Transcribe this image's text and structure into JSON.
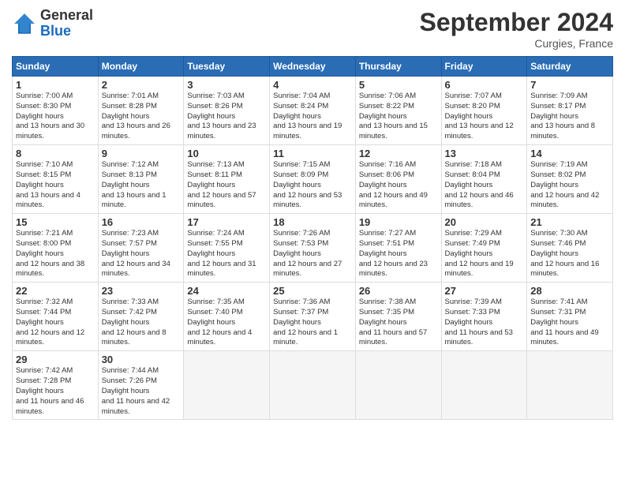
{
  "logo": {
    "general": "General",
    "blue": "Blue"
  },
  "title": "September 2024",
  "location": "Curgies, France",
  "headers": [
    "Sunday",
    "Monday",
    "Tuesday",
    "Wednesday",
    "Thursday",
    "Friday",
    "Saturday"
  ],
  "weeks": [
    [
      {
        "day": "1",
        "sunrise": "7:00 AM",
        "sunset": "8:30 PM",
        "daylight": "13 hours and 30 minutes."
      },
      {
        "day": "2",
        "sunrise": "7:01 AM",
        "sunset": "8:28 PM",
        "daylight": "13 hours and 26 minutes."
      },
      {
        "day": "3",
        "sunrise": "7:03 AM",
        "sunset": "8:26 PM",
        "daylight": "13 hours and 23 minutes."
      },
      {
        "day": "4",
        "sunrise": "7:04 AM",
        "sunset": "8:24 PM",
        "daylight": "13 hours and 19 minutes."
      },
      {
        "day": "5",
        "sunrise": "7:06 AM",
        "sunset": "8:22 PM",
        "daylight": "13 hours and 15 minutes."
      },
      {
        "day": "6",
        "sunrise": "7:07 AM",
        "sunset": "8:20 PM",
        "daylight": "13 hours and 12 minutes."
      },
      {
        "day": "7",
        "sunrise": "7:09 AM",
        "sunset": "8:17 PM",
        "daylight": "13 hours and 8 minutes."
      }
    ],
    [
      {
        "day": "8",
        "sunrise": "7:10 AM",
        "sunset": "8:15 PM",
        "daylight": "13 hours and 4 minutes."
      },
      {
        "day": "9",
        "sunrise": "7:12 AM",
        "sunset": "8:13 PM",
        "daylight": "13 hours and 1 minute."
      },
      {
        "day": "10",
        "sunrise": "7:13 AM",
        "sunset": "8:11 PM",
        "daylight": "12 hours and 57 minutes."
      },
      {
        "day": "11",
        "sunrise": "7:15 AM",
        "sunset": "8:09 PM",
        "daylight": "12 hours and 53 minutes."
      },
      {
        "day": "12",
        "sunrise": "7:16 AM",
        "sunset": "8:06 PM",
        "daylight": "12 hours and 49 minutes."
      },
      {
        "day": "13",
        "sunrise": "7:18 AM",
        "sunset": "8:04 PM",
        "daylight": "12 hours and 46 minutes."
      },
      {
        "day": "14",
        "sunrise": "7:19 AM",
        "sunset": "8:02 PM",
        "daylight": "12 hours and 42 minutes."
      }
    ],
    [
      {
        "day": "15",
        "sunrise": "7:21 AM",
        "sunset": "8:00 PM",
        "daylight": "12 hours and 38 minutes."
      },
      {
        "day": "16",
        "sunrise": "7:23 AM",
        "sunset": "7:57 PM",
        "daylight": "12 hours and 34 minutes."
      },
      {
        "day": "17",
        "sunrise": "7:24 AM",
        "sunset": "7:55 PM",
        "daylight": "12 hours and 31 minutes."
      },
      {
        "day": "18",
        "sunrise": "7:26 AM",
        "sunset": "7:53 PM",
        "daylight": "12 hours and 27 minutes."
      },
      {
        "day": "19",
        "sunrise": "7:27 AM",
        "sunset": "7:51 PM",
        "daylight": "12 hours and 23 minutes."
      },
      {
        "day": "20",
        "sunrise": "7:29 AM",
        "sunset": "7:49 PM",
        "daylight": "12 hours and 19 minutes."
      },
      {
        "day": "21",
        "sunrise": "7:30 AM",
        "sunset": "7:46 PM",
        "daylight": "12 hours and 16 minutes."
      }
    ],
    [
      {
        "day": "22",
        "sunrise": "7:32 AM",
        "sunset": "7:44 PM",
        "daylight": "12 hours and 12 minutes."
      },
      {
        "day": "23",
        "sunrise": "7:33 AM",
        "sunset": "7:42 PM",
        "daylight": "12 hours and 8 minutes."
      },
      {
        "day": "24",
        "sunrise": "7:35 AM",
        "sunset": "7:40 PM",
        "daylight": "12 hours and 4 minutes."
      },
      {
        "day": "25",
        "sunrise": "7:36 AM",
        "sunset": "7:37 PM",
        "daylight": "12 hours and 1 minute."
      },
      {
        "day": "26",
        "sunrise": "7:38 AM",
        "sunset": "7:35 PM",
        "daylight": "11 hours and 57 minutes."
      },
      {
        "day": "27",
        "sunrise": "7:39 AM",
        "sunset": "7:33 PM",
        "daylight": "11 hours and 53 minutes."
      },
      {
        "day": "28",
        "sunrise": "7:41 AM",
        "sunset": "7:31 PM",
        "daylight": "11 hours and 49 minutes."
      }
    ],
    [
      {
        "day": "29",
        "sunrise": "7:42 AM",
        "sunset": "7:28 PM",
        "daylight": "11 hours and 46 minutes."
      },
      {
        "day": "30",
        "sunrise": "7:44 AM",
        "sunset": "7:26 PM",
        "daylight": "11 hours and 42 minutes."
      },
      null,
      null,
      null,
      null,
      null
    ]
  ]
}
